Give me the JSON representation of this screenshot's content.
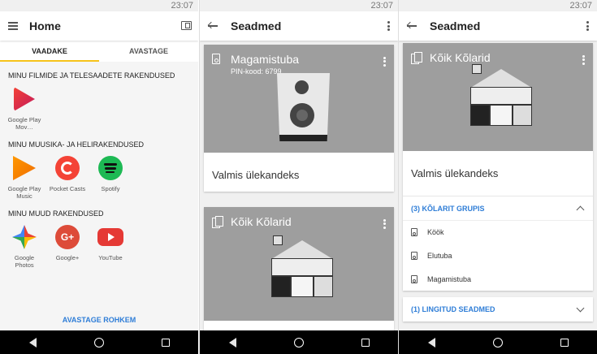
{
  "status": {
    "time": "23:07"
  },
  "screen1": {
    "title": "Home",
    "tabs": [
      "VAADAKE",
      "AVASTAGE"
    ],
    "sections": [
      {
        "title": "MINU FILMIDE JA TELESAADETE RAKENDUSED",
        "apps": [
          {
            "name": "Google Play Mov…",
            "icon": "play-movies-icon",
            "color": "#d32f2f"
          }
        ]
      },
      {
        "title": "MINU MUUSIKA- JA HELIRAKENDUSED",
        "apps": [
          {
            "name": "Google Play Music",
            "icon": "play-music-icon",
            "color": "#ff6f00"
          },
          {
            "name": "Pocket Casts",
            "icon": "pocket-casts-icon",
            "color": "#f44336"
          },
          {
            "name": "Spotify",
            "icon": "spotify-icon",
            "color": "#1db954"
          }
        ]
      },
      {
        "title": "MINU MUUD RAKENDUSED",
        "apps": [
          {
            "name": "Google Photos",
            "icon": "photos-icon",
            "color": "#4caf50"
          },
          {
            "name": "Google+",
            "icon": "google-plus-icon",
            "color": "#dd4b39"
          },
          {
            "name": "YouTube",
            "icon": "youtube-icon",
            "color": "#e53935"
          }
        ]
      }
    ],
    "more": "AVASTAGE ROHKEM"
  },
  "screen2": {
    "title": "Seadmed",
    "card1": {
      "title": "Magamistuba",
      "pin": "PIN-kood: 6799",
      "status": "Valmis ülekandeks"
    },
    "card2": {
      "title": "Kõik Kõlarid"
    }
  },
  "screen3": {
    "title": "Seadmed",
    "card": {
      "title": "Kõik Kõlarid",
      "status": "Valmis ülekandeks"
    },
    "group": {
      "header": "(3) KÕLARIT GRUPIS",
      "items": [
        "Köök",
        "Elutuba",
        "Magamistuba"
      ]
    },
    "linked": "(1) LINGITUD SEADMED"
  }
}
